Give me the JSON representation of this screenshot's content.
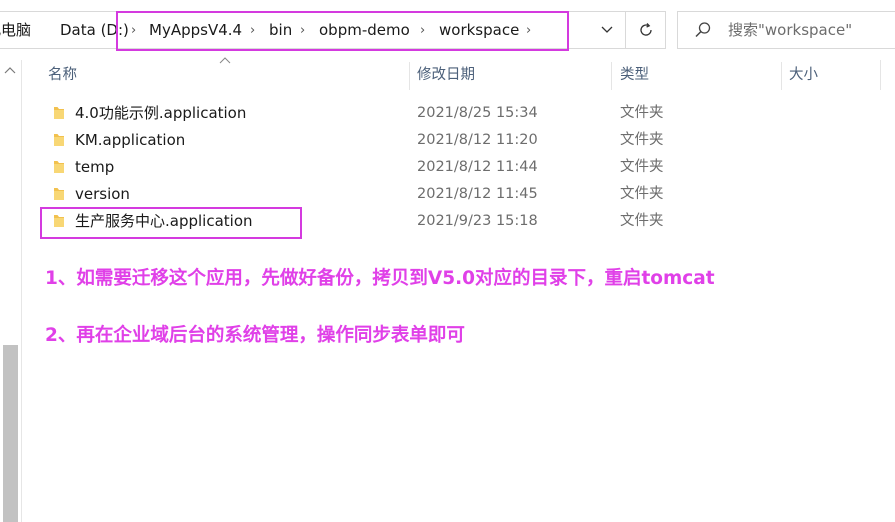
{
  "breadcrumb": {
    "items": [
      "此电脑",
      "Data (D:)",
      "MyAppsV4.4",
      "bin",
      "obpm-demo",
      "workspace"
    ]
  },
  "search": {
    "placeholder": "搜索\"workspace\""
  },
  "columns": {
    "name": "名称",
    "date": "修改日期",
    "type": "类型",
    "size": "大小"
  },
  "files": [
    {
      "name": "4.0功能示例.application",
      "date": "2021/8/25 15:34",
      "type": "文件夹"
    },
    {
      "name": "KM.application",
      "date": "2021/8/12 11:20",
      "type": "文件夹"
    },
    {
      "name": "temp",
      "date": "2021/8/12 11:44",
      "type": "文件夹"
    },
    {
      "name": "version",
      "date": "2021/8/12 11:45",
      "type": "文件夹"
    },
    {
      "name": "生产服务中心.application",
      "date": "2021/9/23 15:18",
      "type": "文件夹"
    }
  ],
  "notes": [
    "1、如需要迁移这个应用，先做好备份，拷贝到V5.0对应的目录下，重启tomcat",
    "2、再在企业域后台的系统管理，操作同步表单即可"
  ],
  "colors": {
    "highlight": "#d43adf",
    "note_text": "#e040e8",
    "folder": "#f5c542"
  }
}
